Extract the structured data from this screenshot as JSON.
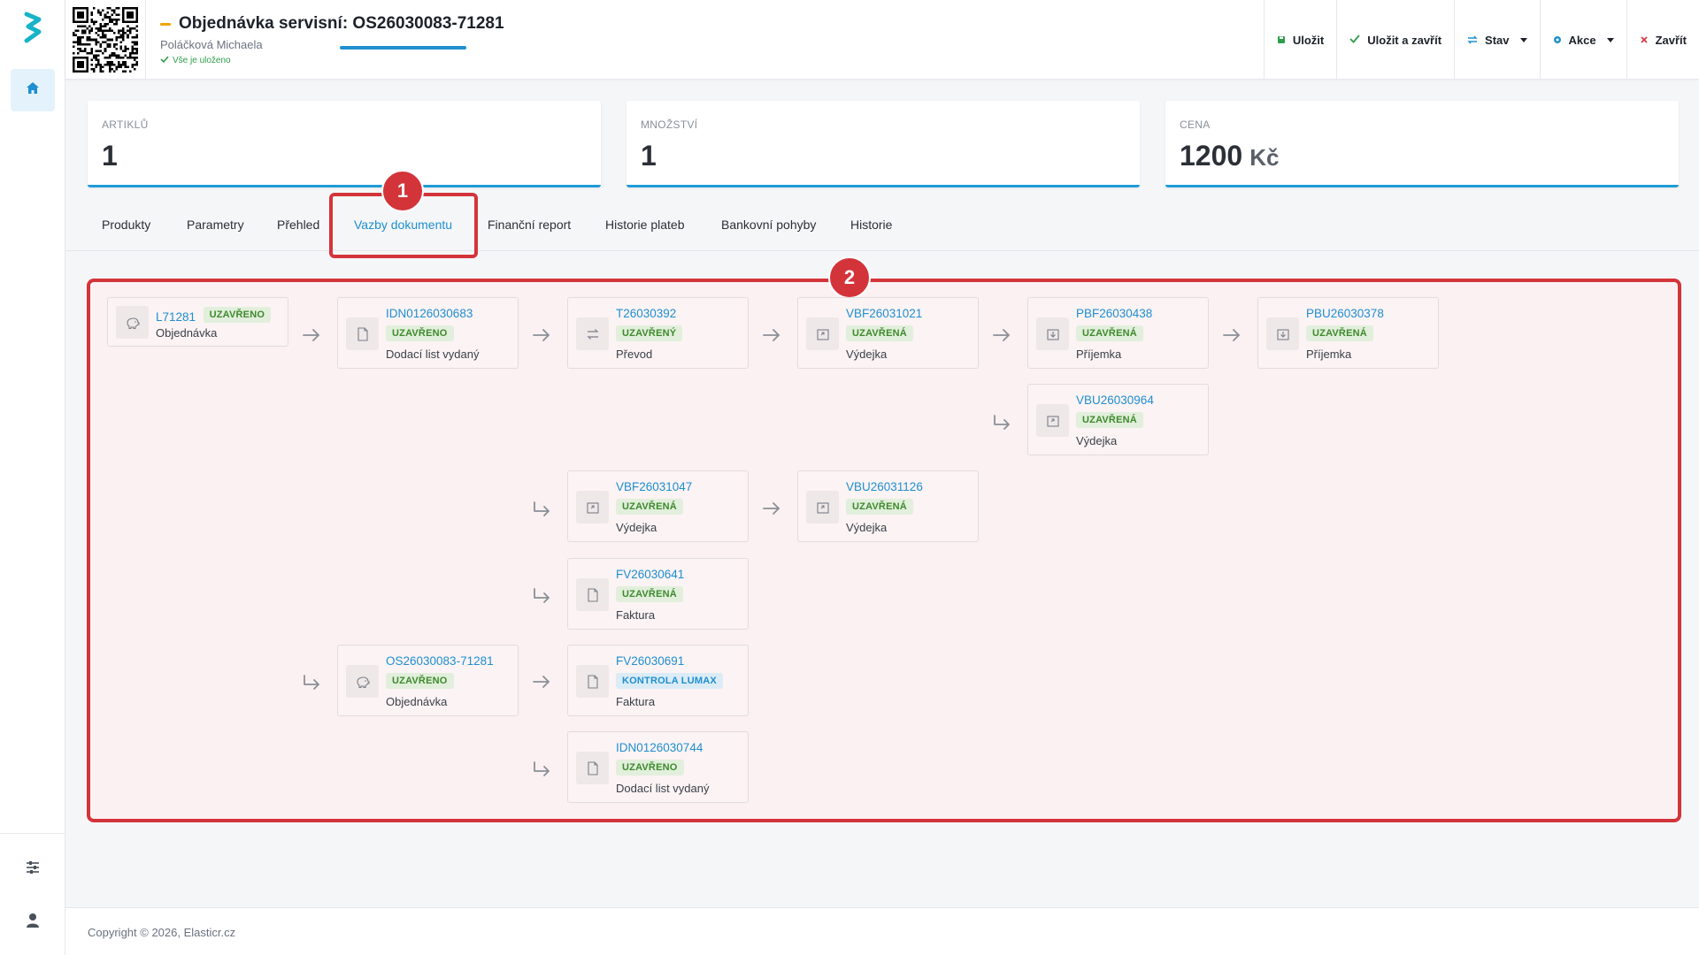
{
  "header": {
    "title": "Objednávka servisní: OS26030083-71281",
    "subtitle": "Poláčková Michaela",
    "saved_status": "Vše je uloženo"
  },
  "toolbar": [
    {
      "label": "Uložit",
      "icon": "save-icon",
      "color": "#2e9e4a"
    },
    {
      "label": "Uložit a zavřít",
      "icon": "check-icon",
      "color": "#2e9e4a"
    },
    {
      "label": "Stav",
      "icon": "swap-icon",
      "color": "#1f8fd0"
    },
    {
      "label": "Akce",
      "icon": "circle-icon",
      "color": "#1f8fd0"
    },
    {
      "label": "Zavřít",
      "icon": "close-icon",
      "color": "#d3343a"
    }
  ],
  "stats": [
    {
      "label": "ARTIKLŮ",
      "value": "1",
      "unit": ""
    },
    {
      "label": "MNOŽSTVÍ",
      "value": "1",
      "unit": ""
    },
    {
      "label": "CENA",
      "value": "1200",
      "unit": "Kč"
    }
  ],
  "tabs": [
    {
      "label": "Produkty"
    },
    {
      "label": "Parametry"
    },
    {
      "label": "Přehled"
    },
    {
      "label": "Vazby dokumentu",
      "active": true
    },
    {
      "label": "Finanční report"
    },
    {
      "label": "Historie plateb"
    },
    {
      "label": "Bankovní pohyby"
    },
    {
      "label": "Historie"
    }
  ],
  "annotations": [
    "1",
    "2"
  ],
  "documents": [
    {
      "id": "L71281",
      "status": "UZAVŘENO",
      "status_kind": "ok",
      "type": "Objednávka",
      "icon": "piggy-bank-icon"
    },
    {
      "id": "IDN0126030683",
      "status": "UZAVŘENO",
      "status_kind": "ok",
      "type": "Dodací list vydaný",
      "icon": "document-icon"
    },
    {
      "id": "T26030392",
      "status": "UZAVŘENÝ",
      "status_kind": "ok",
      "type": "Převod",
      "icon": "transfer-icon"
    },
    {
      "id": "VBF26031021",
      "status": "UZAVŘENÁ",
      "status_kind": "ok",
      "type": "Výdejka",
      "icon": "box-out-icon"
    },
    {
      "id": "PBF26030438",
      "status": "UZAVŘENÁ",
      "status_kind": "ok",
      "type": "Příjemka",
      "icon": "box-in-icon"
    },
    {
      "id": "PBU26030378",
      "status": "UZAVŘENÁ",
      "status_kind": "ok",
      "type": "Příjemka",
      "icon": "box-in-icon"
    },
    {
      "id": "VBU26030964",
      "status": "UZAVŘENÁ",
      "status_kind": "ok",
      "type": "Výdejka",
      "icon": "box-out-icon"
    },
    {
      "id": "VBF26031047",
      "status": "UZAVŘENÁ",
      "status_kind": "ok",
      "type": "Výdejka",
      "icon": "box-out-icon"
    },
    {
      "id": "VBU26031126",
      "status": "UZAVŘENÁ",
      "status_kind": "ok",
      "type": "Výdejka",
      "icon": "box-out-icon"
    },
    {
      "id": "FV26030641",
      "status": "UZAVŘENÁ",
      "status_kind": "ok",
      "type": "Faktura",
      "icon": "document-icon"
    },
    {
      "id": "OS26030083-71281",
      "status": "UZAVŘENO",
      "status_kind": "ok",
      "type": "Objednávka",
      "icon": "piggy-bank-icon"
    },
    {
      "id": "FV26030691",
      "status": "KONTROLA LUMAX",
      "status_kind": "info",
      "type": "Faktura",
      "icon": "document-icon"
    },
    {
      "id": "IDN0126030744",
      "status": "UZAVŘENO",
      "status_kind": "ok",
      "type": "Dodací list vydaný",
      "icon": "document-icon"
    }
  ],
  "footer": {
    "copyright": "Copyright © 2026, Elasticr.cz"
  },
  "colors": {
    "accent": "#1f8fd0",
    "highlight": "#d3343a",
    "success": "#2e9e4a",
    "pending": "#f0a500"
  }
}
